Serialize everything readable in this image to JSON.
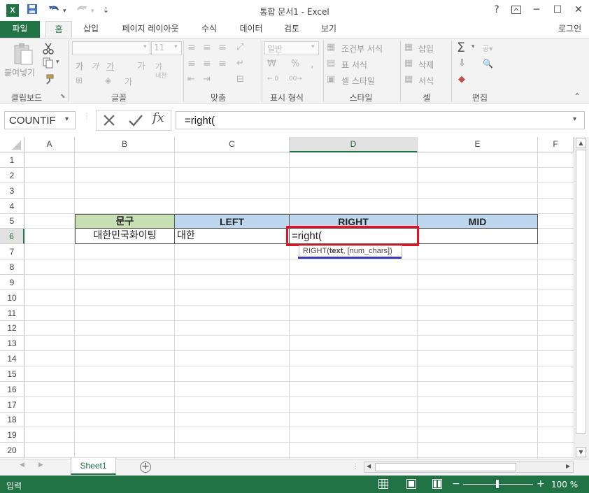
{
  "window": {
    "title": "통합 문서1 - Excel",
    "help": "?",
    "minimize": "─",
    "maximize": "☐",
    "close": "✕",
    "app_icon": "X"
  },
  "ribbon_tabs": {
    "file": "파일",
    "home": "홈",
    "insert": "삽입",
    "page_layout": "페이지 레이아웃",
    "formulas": "수식",
    "data": "데이터",
    "review": "검토",
    "view": "보기",
    "login": "로그인"
  },
  "ribbon": {
    "paste": "붙여넣기",
    "clipboard": "클립보드",
    "font_size": "11",
    "font_group": "글꼴",
    "align_group": "맞춤",
    "number_format": "일반",
    "number_group": "표시 형식",
    "conditional": "조건부 서식",
    "table_format": "표 서식",
    "cell_style": "셀 스타일",
    "style_group": "스타일",
    "insert": "삽입",
    "delete": "삭제",
    "format": "서식",
    "cells_group": "셀",
    "edit_group": "편집",
    "wrap": "내림",
    "percent": "%",
    "comma": ","
  },
  "formula_bar": {
    "name_box": "COUNTIF",
    "fx": "fx",
    "formula": "=right("
  },
  "columns": [
    "A",
    "B",
    "C",
    "D",
    "E",
    "F"
  ],
  "rows": [
    "1",
    "2",
    "3",
    "4",
    "5",
    "6",
    "7",
    "8",
    "9",
    "10",
    "11",
    "12",
    "13",
    "14",
    "15",
    "16",
    "17",
    "18",
    "19",
    "20"
  ],
  "table": {
    "headers": [
      "문구",
      "LEFT",
      "RIGHT",
      "MID"
    ],
    "row6": {
      "b": "대한민국화이팅",
      "c": "대한",
      "d": "=right("
    }
  },
  "tooltip": {
    "fn": "RIGHT(",
    "arg_bold": "text",
    "rest": ", [num_chars])"
  },
  "sheets": {
    "tab": "Sheet1",
    "add": "+"
  },
  "status": {
    "mode": "입력",
    "zoom": "100 %"
  },
  "colors": {
    "excel_green": "#217346",
    "header_green": "#c6e0b4",
    "header_blue": "#bdd7ee",
    "highlight_red": "#e81123",
    "underline_blue": "#3a3ab8"
  }
}
